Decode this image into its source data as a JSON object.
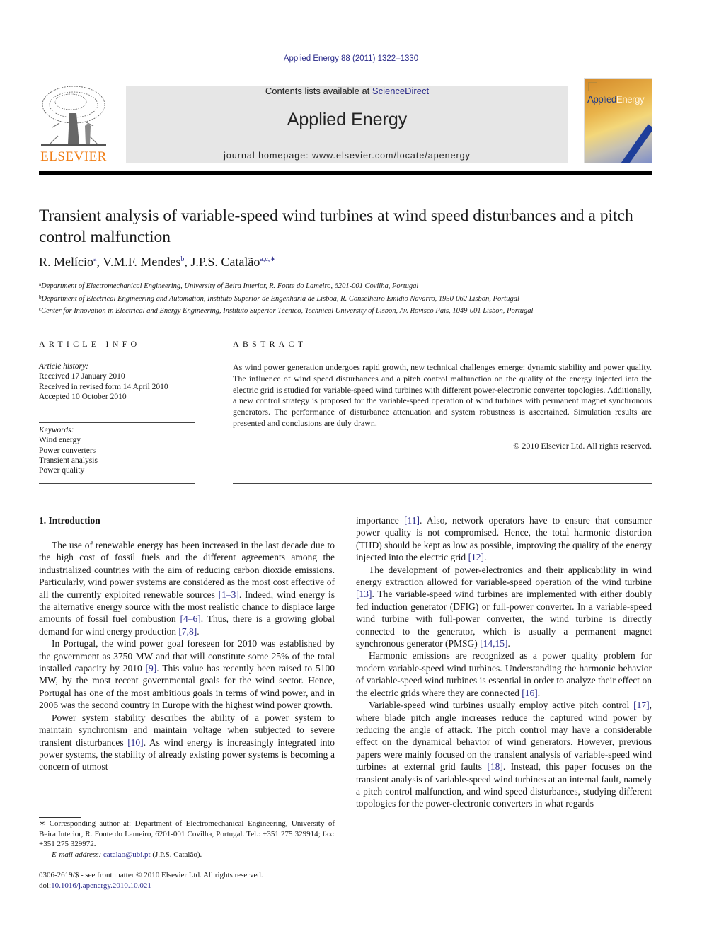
{
  "header": {
    "journal_reference": "Applied Energy 88 (2011) 1322–1330",
    "contents_prefix": "Contents lists available at ",
    "contents_link": "ScienceDirect",
    "journal_title": "Applied Energy",
    "homepage": "journal homepage: www.elsevier.com/locate/apenergy",
    "publisher_logo_text": "ELSEVIER",
    "cover_title_part1": "Applied",
    "cover_title_part2": "Energy",
    "colors": {
      "publisher_orange": "#f07d14",
      "link_blue": "#2a2a8a",
      "masthead_gray": "#e6e6e6"
    }
  },
  "article": {
    "title": "Transient analysis of variable-speed wind turbines at wind speed disturbances and a pitch control malfunction",
    "authors": [
      {
        "name": "R. Melício",
        "sup": "a"
      },
      {
        "name": "V.M.F. Mendes",
        "sup": "b"
      },
      {
        "name": "J.P.S. Catalão",
        "sup": "a,c,∗"
      }
    ],
    "affiliations": [
      {
        "mark": "a",
        "text": "Department of Electromechanical Engineering, University of Beira Interior, R. Fonte do Lameiro, 6201-001 Covilha, Portugal"
      },
      {
        "mark": "b",
        "text": "Department of Electrical Engineering and Automation, Instituto Superior de Engenharia de Lisboa, R. Conselheiro Emídio Navarro, 1950-062 Lisbon, Portugal"
      },
      {
        "mark": "c",
        "text": "Center for Innovation in Electrical and Energy Engineering, Instituto Superior Técnico, Technical University of Lisbon, Av. Rovisco Pais, 1049-001 Lisbon, Portugal"
      }
    ]
  },
  "article_info": {
    "heading": "ARTICLE INFO",
    "history_label": "Article history:",
    "history": [
      "Received 17 January 2010",
      "Received in revised form 14 April 2010",
      "Accepted 10 October 2010"
    ],
    "keywords_label": "Keywords:",
    "keywords": [
      "Wind energy",
      "Power converters",
      "Transient analysis",
      "Power quality"
    ]
  },
  "abstract": {
    "heading": "ABSTRACT",
    "text": "As wind power generation undergoes rapid growth, new technical challenges emerge: dynamic stability and power quality. The influence of wind speed disturbances and a pitch control malfunction on the quality of the energy injected into the electric grid is studied for variable-speed wind turbines with different power-electronic converter topologies. Additionally, a new control strategy is proposed for the variable-speed operation of wind turbines with permanent magnet synchronous generators. The performance of disturbance attenuation and system robustness is ascertained. Simulation results are presented and conclusions are duly drawn.",
    "copyright": "© 2010 Elsevier Ltd. All rights reserved."
  },
  "body": {
    "section_heading": "1. Introduction",
    "left_paragraphs": [
      [
        {
          "t": "The use of renewable energy has been increased in the last decade due to the high cost of fossil fuels and the different agreements among the industrialized countries with the aim of reducing carbon dioxide emissions. Particularly, wind power systems are considered as the most cost effective of all the currently exploited renewable sources "
        },
        {
          "c": "[1–3]"
        },
        {
          "t": ". Indeed, wind energy is the alternative energy source with the most realistic chance to displace large amounts of fossil fuel combustion "
        },
        {
          "c": "[4–6]"
        },
        {
          "t": ". Thus, there is a growing global demand for wind energy production "
        },
        {
          "c": "[7,8]"
        },
        {
          "t": "."
        }
      ],
      [
        {
          "t": "In Portugal, the wind power goal foreseen for 2010 was established by the government as 3750 MW and that will constitute some 25% of the total installed capacity by 2010 "
        },
        {
          "c": "[9]"
        },
        {
          "t": ". This value has recently been raised to 5100 MW, by the most recent governmental goals for the wind sector. Hence, Portugal has one of the most ambitious goals in terms of wind power, and in 2006 was the second country in Europe with the highest wind power growth."
        }
      ],
      [
        {
          "t": "Power system stability describes the ability of a power system to maintain synchronism and maintain voltage when subjected to severe transient disturbances "
        },
        {
          "c": "[10]"
        },
        {
          "t": ". As wind energy is increasingly integrated into power systems, the stability of already existing power systems is becoming a concern of utmost"
        }
      ]
    ],
    "right_paragraphs": [
      [
        {
          "t": "importance "
        },
        {
          "c": "[11]"
        },
        {
          "t": ". Also, network operators have to ensure that consumer power quality is not compromised. Hence, the total harmonic distortion (THD) should be kept as low as possible, improving the quality of the energy injected into the electric grid "
        },
        {
          "c": "[12]"
        },
        {
          "t": "."
        }
      ],
      [
        {
          "t": "The development of power-electronics and their applicability in wind energy extraction allowed for variable-speed operation of the wind turbine "
        },
        {
          "c": "[13]"
        },
        {
          "t": ". The variable-speed wind turbines are implemented with either doubly fed induction generator (DFIG) or full-power converter. In a variable-speed wind turbine with full-power converter, the wind turbine is directly connected to the generator, which is usually a permanent magnet synchronous generator (PMSG) "
        },
        {
          "c": "[14,15]"
        },
        {
          "t": "."
        }
      ],
      [
        {
          "t": "Harmonic emissions are recognized as a power quality problem for modern variable-speed wind turbines. Understanding the harmonic behavior of variable-speed wind turbines is essential in order to analyze their effect on the electric grids where they are connected "
        },
        {
          "c": "[16]"
        },
        {
          "t": "."
        }
      ],
      [
        {
          "t": "Variable-speed wind turbines usually employ active pitch control "
        },
        {
          "c": "[17]"
        },
        {
          "t": ", where blade pitch angle increases reduce the captured wind power by reducing the angle of attack. The pitch control may have a considerable effect on the dynamical behavior of wind generators. However, previous papers were mainly focused on the transient analysis of variable-speed wind turbines at external grid faults "
        },
        {
          "c": "[18]"
        },
        {
          "t": ". Instead, this paper focuses on the transient analysis of variable-speed wind turbines at an internal fault, namely a pitch control malfunction, and wind speed disturbances, studying different topologies for the power-electronic converters in what regards"
        }
      ]
    ]
  },
  "footnote": {
    "corresponding": "∗ Corresponding author at: Department of Electromechanical Engineering, University of Beira Interior, R. Fonte do Lameiro, 6201-001 Covilha, Portugal. Tel.: +351 275 329914; fax: +351 275 329972.",
    "email_label": "E-mail address:",
    "email": "catalao@ubi.pt",
    "email_owner": " (J.P.S. Catalão).",
    "front_matter": "0306-2619/$ - see front matter © 2010 Elsevier Ltd. All rights reserved.",
    "doi_prefix": "doi:",
    "doi": "10.1016/j.apenergy.2010.10.021"
  }
}
